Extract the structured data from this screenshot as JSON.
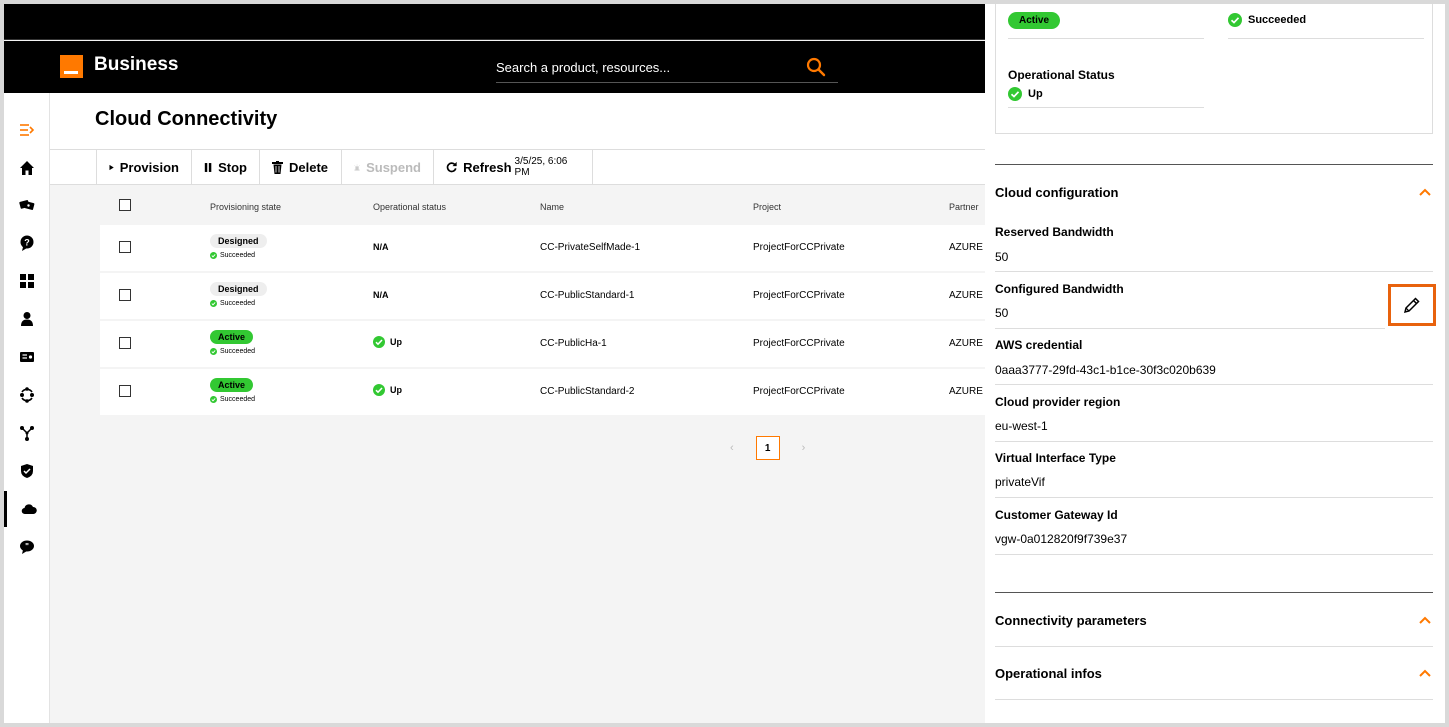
{
  "header": {
    "brand": "Business",
    "search_placeholder": "Search a product, resources..."
  },
  "sidebar": {
    "items": [
      "menu-collapse-icon",
      "home-icon",
      "tickets-icon",
      "help-icon",
      "dashboard-icon",
      "user-icon",
      "contract-icon",
      "network-icon",
      "topology-icon",
      "security-icon",
      "cloud-icon",
      "chat-icon"
    ]
  },
  "main": {
    "title": "Cloud Connectivity",
    "toolbar": {
      "provision": "Provision",
      "stop": "Stop",
      "delete": "Delete",
      "suspend": "Suspend",
      "refresh": "Refresh",
      "refresh_time": "3/5/25, 6:06 PM"
    },
    "table": {
      "columns": [
        "Provisioning state",
        "Operational status",
        "Name",
        "Project",
        "Partner"
      ],
      "rows": [
        {
          "state": "Designed",
          "substate": "Succeeded",
          "op": "N/A",
          "name": "CC-PrivateSelfMade-1",
          "project": "ProjectForCCPrivate",
          "partner": "AZURE"
        },
        {
          "state": "Designed",
          "substate": "Succeeded",
          "op": "N/A",
          "name": "CC-PublicStandard-1",
          "project": "ProjectForCCPrivate",
          "partner": "AZURE"
        },
        {
          "state": "Active",
          "substate": "Succeeded",
          "op": "Up",
          "name": "CC-PublicHa-1",
          "project": "ProjectForCCPrivate",
          "partner": "AZURE"
        },
        {
          "state": "Active",
          "substate": "Succeeded",
          "op": "Up",
          "name": "CC-PublicStandard-2",
          "project": "ProjectForCCPrivate",
          "partner": "AZURE"
        }
      ]
    },
    "pagination": {
      "prev": "‹",
      "current": "1",
      "next": "›"
    }
  },
  "panel": {
    "status": {
      "active_badge": "Active",
      "succeeded": "Succeeded",
      "operational_status_label": "Operational Status",
      "operational_status_value": "Up"
    },
    "cloud_configuration": {
      "title": "Cloud configuration",
      "fields": [
        {
          "label": "Reserved Bandwidth",
          "value": "50"
        },
        {
          "label": "Configured Bandwidth",
          "value": "50"
        },
        {
          "label": "AWS credential",
          "value": "0aaa3777-29fd-43c1-b1ce-30f3c020b639"
        },
        {
          "label": "Cloud provider region",
          "value": "eu-west-1"
        },
        {
          "label": "Virtual Interface Type",
          "value": "privateVif"
        },
        {
          "label": "Customer Gateway Id",
          "value": "vgw-0a012820f9f739e37"
        }
      ]
    },
    "connectivity_parameters": "Connectivity parameters",
    "operational_infos": "Operational infos"
  },
  "colors": {
    "accent": "#ff7900",
    "success": "#32c832",
    "highlight": "#e8620d"
  }
}
